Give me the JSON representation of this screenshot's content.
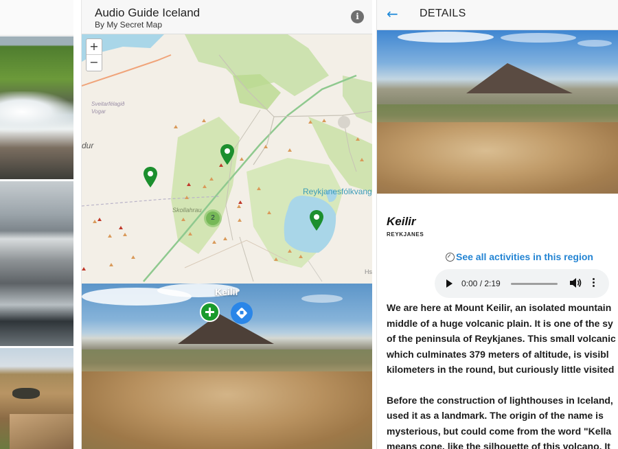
{
  "app": {
    "title": "Audio Guide Iceland",
    "subtitle": "By My Secret Map"
  },
  "map": {
    "zoom_in": "+",
    "zoom_out": "−",
    "labels": {
      "sveitarfelagid": "Sveitarfélagið Vogar",
      "dur": "dur",
      "skolla": "Skollahrau",
      "reykjanes": "Reykjanesfólkvang",
      "hs": "Hs"
    },
    "cluster_count": "2"
  },
  "preview": {
    "title": "Keilir"
  },
  "details": {
    "header_title": "DETAILS",
    "place_name": "Keilir",
    "place_region": "REYKJANES",
    "activities_link": "See all activities in this region",
    "audio": {
      "time": "0:00 / 2:19"
    },
    "description": [
      "We are here at Mount Keilir, an isolated mountain",
      "middle of a huge volcanic plain. It is one of the sy",
      "of the peninsula of Reykjanes. This small volcanic",
      "which culminates 379 meters of altitude, is visibl",
      "kilometers in the round, but curiously little visited"
    ],
    "description2": [
      "Before the construction of lighthouses in Iceland,",
      "used it as a landmark. The origin of the name is",
      "mysterious, but could come from the word \"Kella",
      "means cone, like the silhouette of this volcano. It"
    ]
  },
  "colors": {
    "accent": "#2384d3",
    "pin_green": "#1c8f2e",
    "add_green": "#1a9a2c",
    "direction_blue": "#2a86e8"
  },
  "icons": {
    "info": "info-icon",
    "back": "arrow-left-icon",
    "add": "plus-icon",
    "directions": "directions-icon",
    "activities": "compass-icon",
    "play": "play-icon",
    "volume": "volume-icon",
    "more": "more-vertical-icon"
  }
}
